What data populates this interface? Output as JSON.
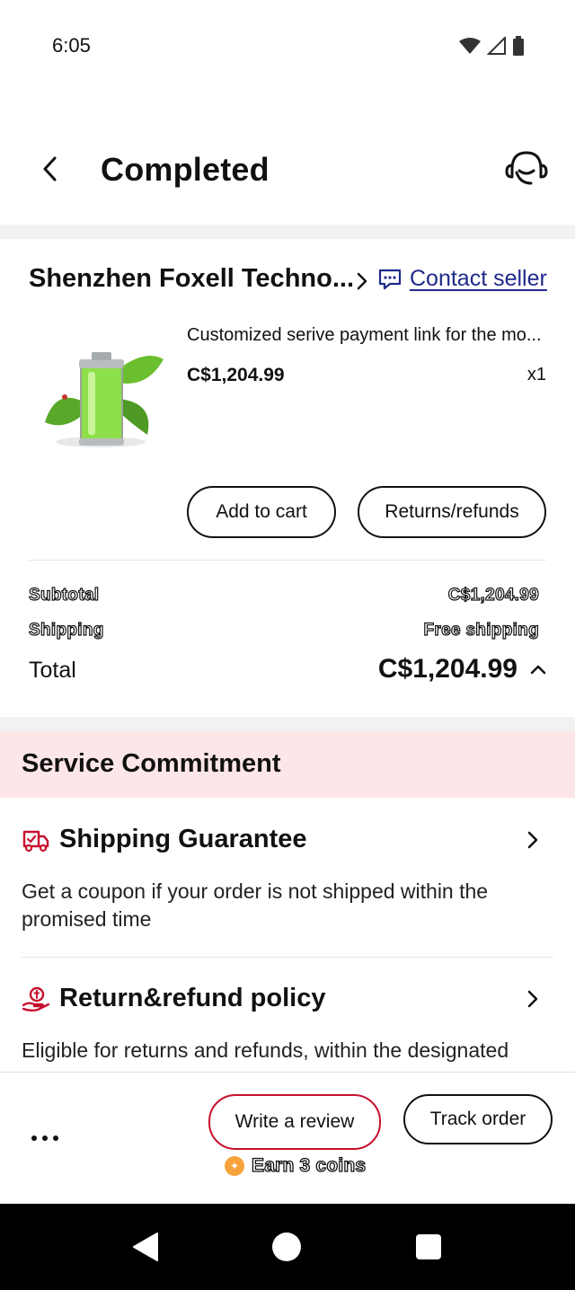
{
  "status_bar": {
    "time": "6:05"
  },
  "header": {
    "title": "Completed"
  },
  "store": {
    "name": "Shenzhen Foxell Techno...",
    "contact_label": "Contact seller"
  },
  "product": {
    "title": "Customized serive payment link for the mo...",
    "price": "C$1,204.99",
    "quantity": "x1",
    "add_to_cart_label": "Add to cart",
    "returns_label": "Returns/refunds"
  },
  "summary": {
    "subtotal_label": "Subtotal",
    "subtotal_value": "C$1,204.99",
    "shipping_label": "Shipping",
    "shipping_value": "Free shipping",
    "total_label": "Total",
    "total_value": "C$1,204.99"
  },
  "service": {
    "title": "Service Commitment",
    "items": [
      {
        "title": "Shipping Guarantee",
        "icon": "delivery-truck-icon",
        "description": "Get a coupon if your order is not shipped within the promised time"
      },
      {
        "title": "Return&refund policy",
        "icon": "refund-hand-icon",
        "description": "Eligible for returns and refunds, within the designated"
      }
    ]
  },
  "bottom_bar": {
    "review_label": "Write a review",
    "track_label": "Track order",
    "earn_label": "Earn 3 coins"
  },
  "colors": {
    "accent_red": "#c8102e",
    "link_blue": "#1f2a8a",
    "service_banner": "#fde6e8",
    "coin": "#f7a23b"
  }
}
